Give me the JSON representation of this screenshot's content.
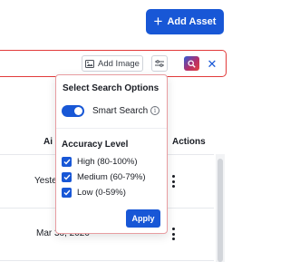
{
  "header": {
    "add_asset_label": "Add Asset"
  },
  "search": {
    "add_image_label": "Add Image"
  },
  "table": {
    "headers": {
      "ai": "Ai",
      "actions": "Actions"
    },
    "rows": [
      {
        "date": "Yeste"
      },
      {
        "date": "Mar 3o, 2020"
      }
    ]
  },
  "search_options": {
    "title": "Select Search Options",
    "smart_search": {
      "label": "Smart Search",
      "enabled": true
    },
    "accuracy": {
      "title": "Accuracy Level",
      "levels": [
        {
          "label": "High (80-100%)",
          "checked": true
        },
        {
          "label": "Medium (60-79%)",
          "checked": true
        },
        {
          "label": "Low (0-59%)",
          "checked": true
        }
      ]
    },
    "apply_label": "Apply"
  },
  "colors": {
    "primary": "#1857d6",
    "error_border": "#e23b3b",
    "popover_border": "#e89da1"
  },
  "icons": [
    "plus-icon",
    "image-icon",
    "filter-icon",
    "search-icon",
    "close-icon",
    "info-icon",
    "check-icon",
    "kebab-icon"
  ]
}
